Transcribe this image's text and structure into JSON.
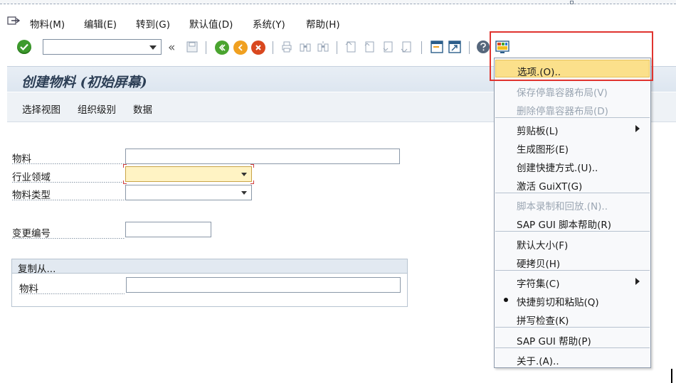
{
  "menubar": {
    "items": [
      "物料(M)",
      "编辑(E)",
      "转到(G)",
      "默认值(D)",
      "系统(Y)",
      "帮助(H)"
    ]
  },
  "toolbar": {
    "command_value": "",
    "nav_back_symbol": "«"
  },
  "title": "创建物料 (初始屏幕)",
  "app_toolbar": {
    "items": [
      "选择视图",
      "组织级别",
      "数据"
    ]
  },
  "form": {
    "material_label": "物料",
    "material_value": "",
    "industry_label": "行业领域",
    "industry_value": "",
    "type_label": "物料类型",
    "type_value": "",
    "change_no_label": "变更编号",
    "change_no_value": "",
    "copy_from_title": "复制从...",
    "copy_material_label": "物料",
    "copy_material_value": ""
  },
  "options_menu": {
    "items": [
      {
        "label": "选项.(O)..",
        "state": "highlighted"
      },
      {
        "label": "保存停靠容器布局(V)",
        "state": "disabled"
      },
      {
        "label": "删除停靠容器布局(D)",
        "state": "disabled"
      },
      {
        "label": "剪贴板(L)",
        "state": "submenu"
      },
      {
        "label": "生成图形(E)",
        "state": "normal"
      },
      {
        "label": "创建快捷方式.(U)..",
        "state": "normal"
      },
      {
        "label": "激活 GuiXT(G)",
        "state": "normal"
      },
      {
        "label": "脚本录制和回放.(N)..",
        "state": "disabled"
      },
      {
        "label": "SAP GUI 脚本帮助(R)",
        "state": "normal"
      },
      {
        "label": "默认大小(F)",
        "state": "normal"
      },
      {
        "label": "硬拷贝(H)",
        "state": "normal"
      },
      {
        "label": "字符集(C)",
        "state": "submenu"
      },
      {
        "label": "快捷剪切和粘贴(Q)",
        "state": "checked"
      },
      {
        "label": "拼写检查(K)",
        "state": "normal"
      },
      {
        "label": "SAP GUI 帮助(P)",
        "state": "normal"
      },
      {
        "label": "关于.(A)..",
        "state": "normal"
      }
    ]
  },
  "colors": {
    "accent_highlight": "#fbe08b",
    "annotation_red": "#e0342f",
    "ok_green": "#3d9a2d"
  }
}
